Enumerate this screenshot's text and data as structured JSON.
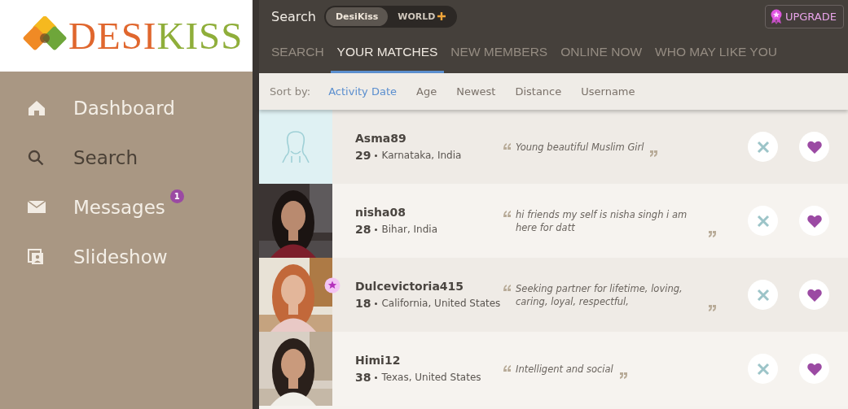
{
  "logo": {
    "part_1": "DESI",
    "part_2": "KISS"
  },
  "sidebar": {
    "items": [
      {
        "label": "Dashboard",
        "selected": false
      },
      {
        "label": "Search",
        "selected": true
      },
      {
        "label": "Messages",
        "selected": false,
        "badge": "1"
      },
      {
        "label": "Slideshow",
        "selected": false
      }
    ]
  },
  "header": {
    "title": "Search",
    "scope_toggle": [
      {
        "label": "DesiKiss",
        "selected": true
      },
      {
        "label": "WORLD",
        "selected": false
      }
    ],
    "upgrade_button": "UPGRADE"
  },
  "tabs": [
    {
      "label": "SEARCH",
      "selected": false
    },
    {
      "label": "YOUR MATCHES",
      "selected": true
    },
    {
      "label": "NEW MEMBERS",
      "selected": false
    },
    {
      "label": "ONLINE NOW",
      "selected": false
    },
    {
      "label": "WHO MAY LIKE YOU",
      "selected": false
    }
  ],
  "sort": {
    "label": "Sort by:",
    "options": [
      {
        "label": "Activity Date",
        "selected": true
      },
      {
        "label": "Age",
        "selected": false
      },
      {
        "label": "Newest",
        "selected": false
      },
      {
        "label": "Distance",
        "selected": false
      },
      {
        "label": "Username",
        "selected": false
      }
    ]
  },
  "matches": [
    {
      "username": "Asma89",
      "age": "29",
      "location": "Karnataka, India",
      "quote": "Young beautiful Muslim Girl",
      "photo": {
        "kind": "placeholder"
      },
      "featured": false
    },
    {
      "username": "nisha08",
      "age": "28",
      "location": "Bihar, India",
      "quote": "hi friends my self is nisha singh i am here for datt",
      "featured": false
    },
    {
      "username": "Dulcevictoria415",
      "age": "18",
      "location": "California, United States",
      "quote": "Seeking partner for lifetime, loving, caring, loyal, respectful,",
      "featured": true
    },
    {
      "username": "Himi12",
      "age": "38",
      "location": "Texas, United States",
      "quote": "Intelligent and social",
      "featured": false
    }
  ]
}
